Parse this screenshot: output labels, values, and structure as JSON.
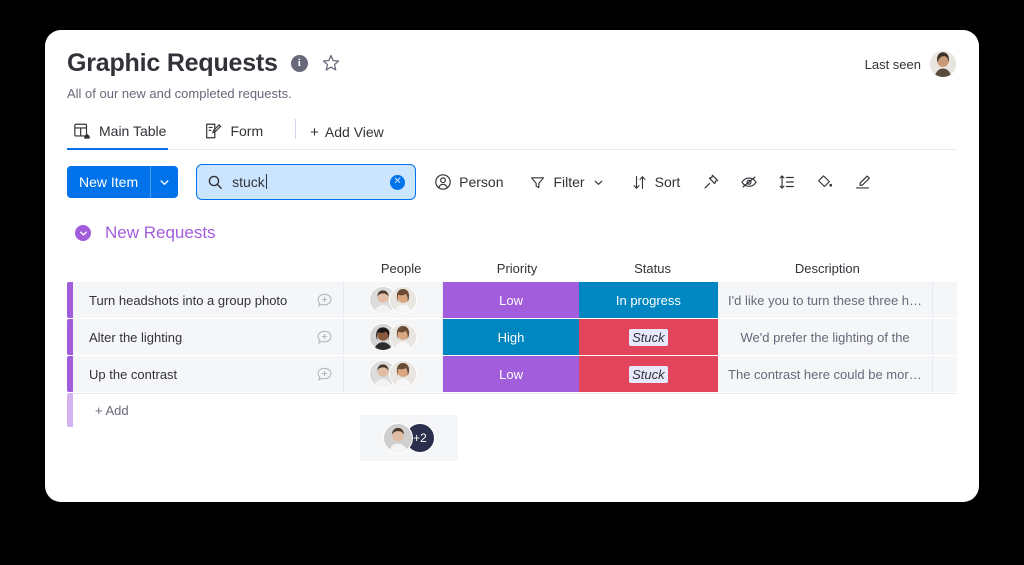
{
  "board": {
    "title": "Graphic Requests",
    "subtitle": "All of our new and completed requests.",
    "info_icon": "info-icon",
    "star_icon": "star-outline-icon",
    "last_seen_label": "Last seen"
  },
  "tabs": [
    {
      "label": "Main Table",
      "icon": "table-home-icon",
      "active": true
    },
    {
      "label": "Form",
      "icon": "form-edit-icon",
      "active": false
    }
  ],
  "add_view": {
    "label": "Add View",
    "plus": "+"
  },
  "toolbar": {
    "new_item_label": "New Item",
    "new_item_caret": "chevron-down-icon",
    "search": {
      "value": "stuck",
      "placeholder": "Search",
      "icon": "search-icon",
      "clear_icon": "clear-circle-icon",
      "clear_glyph": "✕"
    },
    "person_label": "Person",
    "filter_label": "Filter",
    "sort_label": "Sort",
    "icon_buttons": [
      "pin-icon",
      "hide-eye-icon",
      "row-height-icon",
      "paint-bucket-icon",
      "highlighter-pen-icon"
    ]
  },
  "group": {
    "name": "New Requests",
    "color": "#a25ddc",
    "collapse_icon": "chevron-down-circle-icon"
  },
  "columns": [
    {
      "key": "title",
      "label": ""
    },
    {
      "key": "people",
      "label": "People"
    },
    {
      "key": "priority",
      "label": "Priority"
    },
    {
      "key": "status",
      "label": "Status"
    },
    {
      "key": "description",
      "label": "Description"
    }
  ],
  "rows": [
    {
      "title": "Turn headshots into a group photo",
      "priority": "Low",
      "priority_color": "#a25ddc",
      "status": "In progress",
      "status_color": "#0086c0",
      "status_highlighted": false,
      "description": "I'd like you to turn these three he…"
    },
    {
      "title": "Alter the lighting",
      "priority": "High",
      "priority_color": "#0086c0",
      "status": "Stuck",
      "status_color": "#e2445c",
      "status_highlighted": true,
      "description": "We'd prefer the lighting of the"
    },
    {
      "title": "Up the contrast",
      "priority": "Low",
      "priority_color": "#a25ddc",
      "status": "Stuck",
      "status_color": "#e2445c",
      "status_highlighted": true,
      "description": "The contrast here could be more …"
    }
  ],
  "add_row": {
    "label": "+ Add"
  },
  "floating_people": {
    "extra_count": "+2"
  },
  "colors": {
    "primary": "#0073ea",
    "purple": "#a25ddc",
    "blue": "#0086c0",
    "red": "#e2445c",
    "page_background": "#000000",
    "card_background": "#ffffff"
  }
}
